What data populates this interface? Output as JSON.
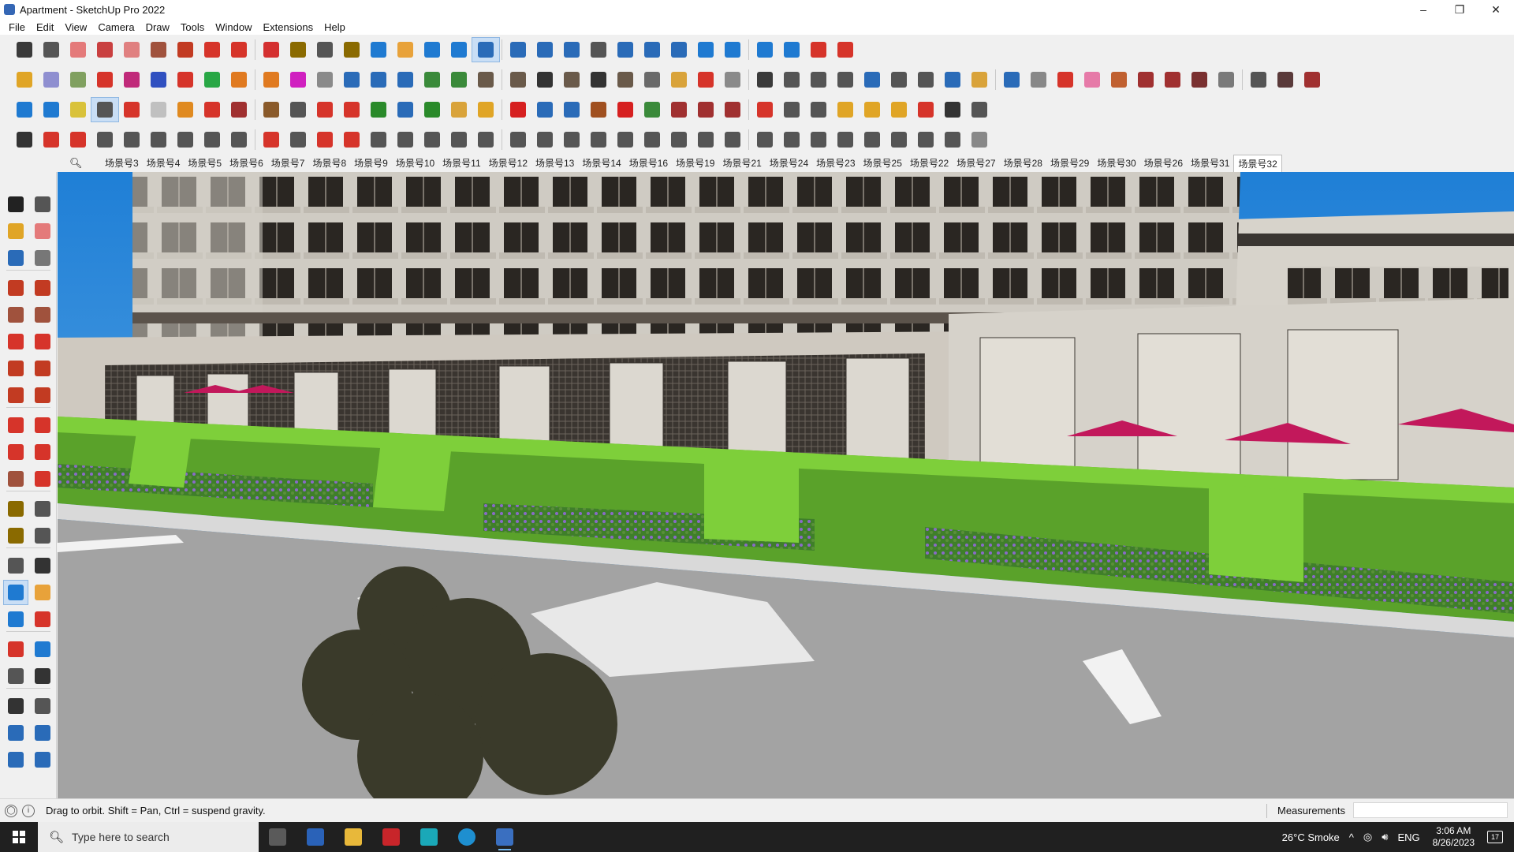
{
  "window": {
    "title": "Apartment - SketchUp Pro 2022",
    "controls": {
      "minimize": "–",
      "maximize": "❐",
      "close": "✕"
    }
  },
  "menu": [
    "File",
    "Edit",
    "View",
    "Camera",
    "Draw",
    "Tools",
    "Window",
    "Extensions",
    "Help"
  ],
  "scenes": {
    "search_icon": "search-icon",
    "tabs": [
      "场景号3",
      "场景号4",
      "场景号5",
      "场景号6",
      "场景号7",
      "场景号8",
      "场景号9",
      "场景号10",
      "场景号11",
      "场景号12",
      "场景号13",
      "场景号14",
      "场景号16",
      "场景号19",
      "场景号21",
      "场景号24",
      "场景号23",
      "场景号25",
      "场景号22",
      "场景号27",
      "场景号28",
      "场景号29",
      "场景号30",
      "场景号26",
      "场景号31",
      "场景号32"
    ],
    "active": "场景号32"
  },
  "toolbar": {
    "row1_colors": [
      "#3a3a3a",
      "#555555",
      "#e47a7a",
      "#c94040",
      "#e08080",
      "#a0523d",
      "#c23b22",
      "#d6342a",
      "#d6342a",
      "#d43030",
      "#8a6a00",
      "#555555",
      "#8a6a00",
      "#1f7ad1",
      "#e8a23a",
      "#1f7ad1",
      "#1f7ad1",
      "#2a6bb8",
      "#2a6bb8",
      "#2a6bb8",
      "#2a6bb8",
      "#555555",
      "#2a6bb8",
      "#2a6bb8",
      "#2a6bb8",
      "#1f7ad1",
      "#1f7ad1",
      "#1f7ad1",
      "#1f7ad1",
      "#d6342a",
      "#d6342a"
    ],
    "row2_colors": [
      "#e0a526",
      "#8f8fd0",
      "#80a060",
      "#d6342a",
      "#c02a7a",
      "#3050c0",
      "#d6342a",
      "#28a745",
      "#e07a20",
      "#e07a20",
      "#d020c0",
      "#8a8a8a",
      "#2a6bb8",
      "#2a6bb8",
      "#2a6bb8",
      "#3a8a3a",
      "#3a8a3a",
      "#6a5a4a",
      "#6a5a4a",
      "#333333",
      "#6a5a4a",
      "#333333",
      "#6a5a4a",
      "#6a6a6a",
      "#d9a33a",
      "#d6342a",
      "#8a8a8a",
      "#3a3a3a",
      "#555555",
      "#555555",
      "#555555",
      "#2a6bb8",
      "#555555",
      "#555555",
      "#2a6bb8",
      "#d9a33a",
      "#2a6bb8",
      "#888888",
      "#d6342a",
      "#e67aa8",
      "#c06030",
      "#a03030",
      "#a03030",
      "#7a3030",
      "#7a7a7a",
      "#555555",
      "#5a3a3a",
      "#a03030"
    ],
    "row3_colors": [
      "#1f7ad1",
      "#1f7ad1",
      "#d9c23a",
      "#555555",
      "#d6342a",
      "#c0c0c0",
      "#e08a20",
      "#d6342a",
      "#a03030",
      "#8a5a2a",
      "#555555",
      "#d6342a",
      "#d6342a",
      "#2a8a2a",
      "#2a6bb8",
      "#2a8a2a",
      "#d9a33a",
      "#e0a526",
      "#d62020",
      "#2a6bb8",
      "#2a6bb8",
      "#a05020",
      "#d62020",
      "#3a8a3a",
      "#a03030",
      "#a03030",
      "#a03030",
      "#d6342a",
      "#555555",
      "#555555",
      "#e0a526",
      "#e0a526",
      "#e0a526",
      "#d6342a",
      "#333333",
      "#555555"
    ],
    "row4_colors": [
      "#333333",
      "#d6342a",
      "#d6342a",
      "#555555",
      "#555555",
      "#555555",
      "#555555",
      "#555555",
      "#555555",
      "#d6342a",
      "#555555",
      "#d6342a",
      "#d6342a",
      "#555555",
      "#555555",
      "#555555",
      "#555555",
      "#555555",
      "#555555",
      "#555555",
      "#555555",
      "#555555",
      "#555555",
      "#555555",
      "#555555",
      "#555555",
      "#555555",
      "#555555",
      "#555555",
      "#555555",
      "#555555",
      "#555555",
      "#555555",
      "#555555",
      "#555555",
      "#888888"
    ]
  },
  "left_palette_colors": [
    "#222222",
    "#555555",
    "#e0a526",
    "#e47a7a",
    "#2a6bb8",
    "#777777",
    "#c23b22",
    "#c23b22",
    "#a0523d",
    "#a0523d",
    "#d6342a",
    "#d6342a",
    "#c23b22",
    "#c23b22",
    "#c23b22",
    "#c23b22",
    "#d6342a",
    "#d6342a",
    "#d6342a",
    "#d6342a",
    "#a0523d",
    "#d6342a",
    "#8a6a00",
    "#555555",
    "#8a6a00",
    "#555555",
    "#555555",
    "#333333",
    "#1f7ad1",
    "#e8a23a",
    "#1f7ad1",
    "#d6342a",
    "#d6342a",
    "#1f7ad1",
    "#555555",
    "#333333",
    "#333333",
    "#555555",
    "#2a6bb8",
    "#2a6bb8",
    "#2a6bb8",
    "#2a6bb8"
  ],
  "status": {
    "message": "Drag to orbit. Shift = Pan, Ctrl = suspend gravity.",
    "measurements_label": "Measurements",
    "measurements_value": ""
  },
  "taskbar": {
    "search_placeholder": "Type here to search",
    "apps": [
      "task-view",
      "calculator",
      "file-explorer",
      "acrobat",
      "3ds-max",
      "edge",
      "sketchup"
    ],
    "weather": "26°C  Smoke",
    "language": "ENG",
    "time": "3:06 AM",
    "date": "8/26/2023",
    "notifications": "17"
  },
  "colors": {
    "sky": "#2e8ed8",
    "building": "#d2cec6",
    "hedge": "#5aa22a",
    "road": "#a3a3a3",
    "umbrella": "#c2185b"
  }
}
